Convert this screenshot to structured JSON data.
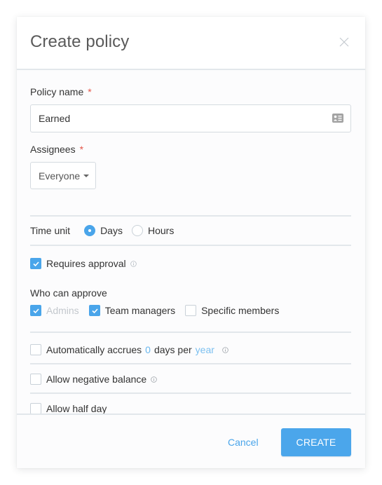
{
  "dialog": {
    "title": "Create policy",
    "close_icon": "close-icon"
  },
  "policy_name": {
    "label": "Policy name",
    "required_mark": "*",
    "value": "Earned",
    "icon": "contact-card-icon"
  },
  "assignees": {
    "label": "Assignees",
    "required_mark": "*",
    "selected": "Everyone",
    "icon": "caret-down-icon"
  },
  "time_unit": {
    "label": "Time unit",
    "options": [
      {
        "label": "Days",
        "checked": true
      },
      {
        "label": "Hours",
        "checked": false
      }
    ]
  },
  "requires_approval": {
    "label": "Requires approval",
    "checked": true,
    "icon": "info-icon"
  },
  "who_can_approve": {
    "label": "Who can approve",
    "options": [
      {
        "label": "Admins",
        "checked": true,
        "disabled": true
      },
      {
        "label": "Team managers",
        "checked": true,
        "disabled": false
      },
      {
        "label": "Specific members",
        "checked": false,
        "disabled": false
      }
    ]
  },
  "accrual": {
    "checked": false,
    "text_before": "Automatically accrues",
    "amount": "0",
    "text_middle": "days per",
    "period": "year",
    "icon": "info-icon"
  },
  "negative_balance": {
    "label": "Allow negative balance",
    "checked": false,
    "icon": "info-icon"
  },
  "half_day": {
    "label": "Allow half day",
    "checked": false
  },
  "footer": {
    "cancel_label": "Cancel",
    "create_label": "CREATE"
  },
  "colors": {
    "accent": "#4ba6eb",
    "required": "#e4574a",
    "disabled_text": "#c3c8cd"
  }
}
